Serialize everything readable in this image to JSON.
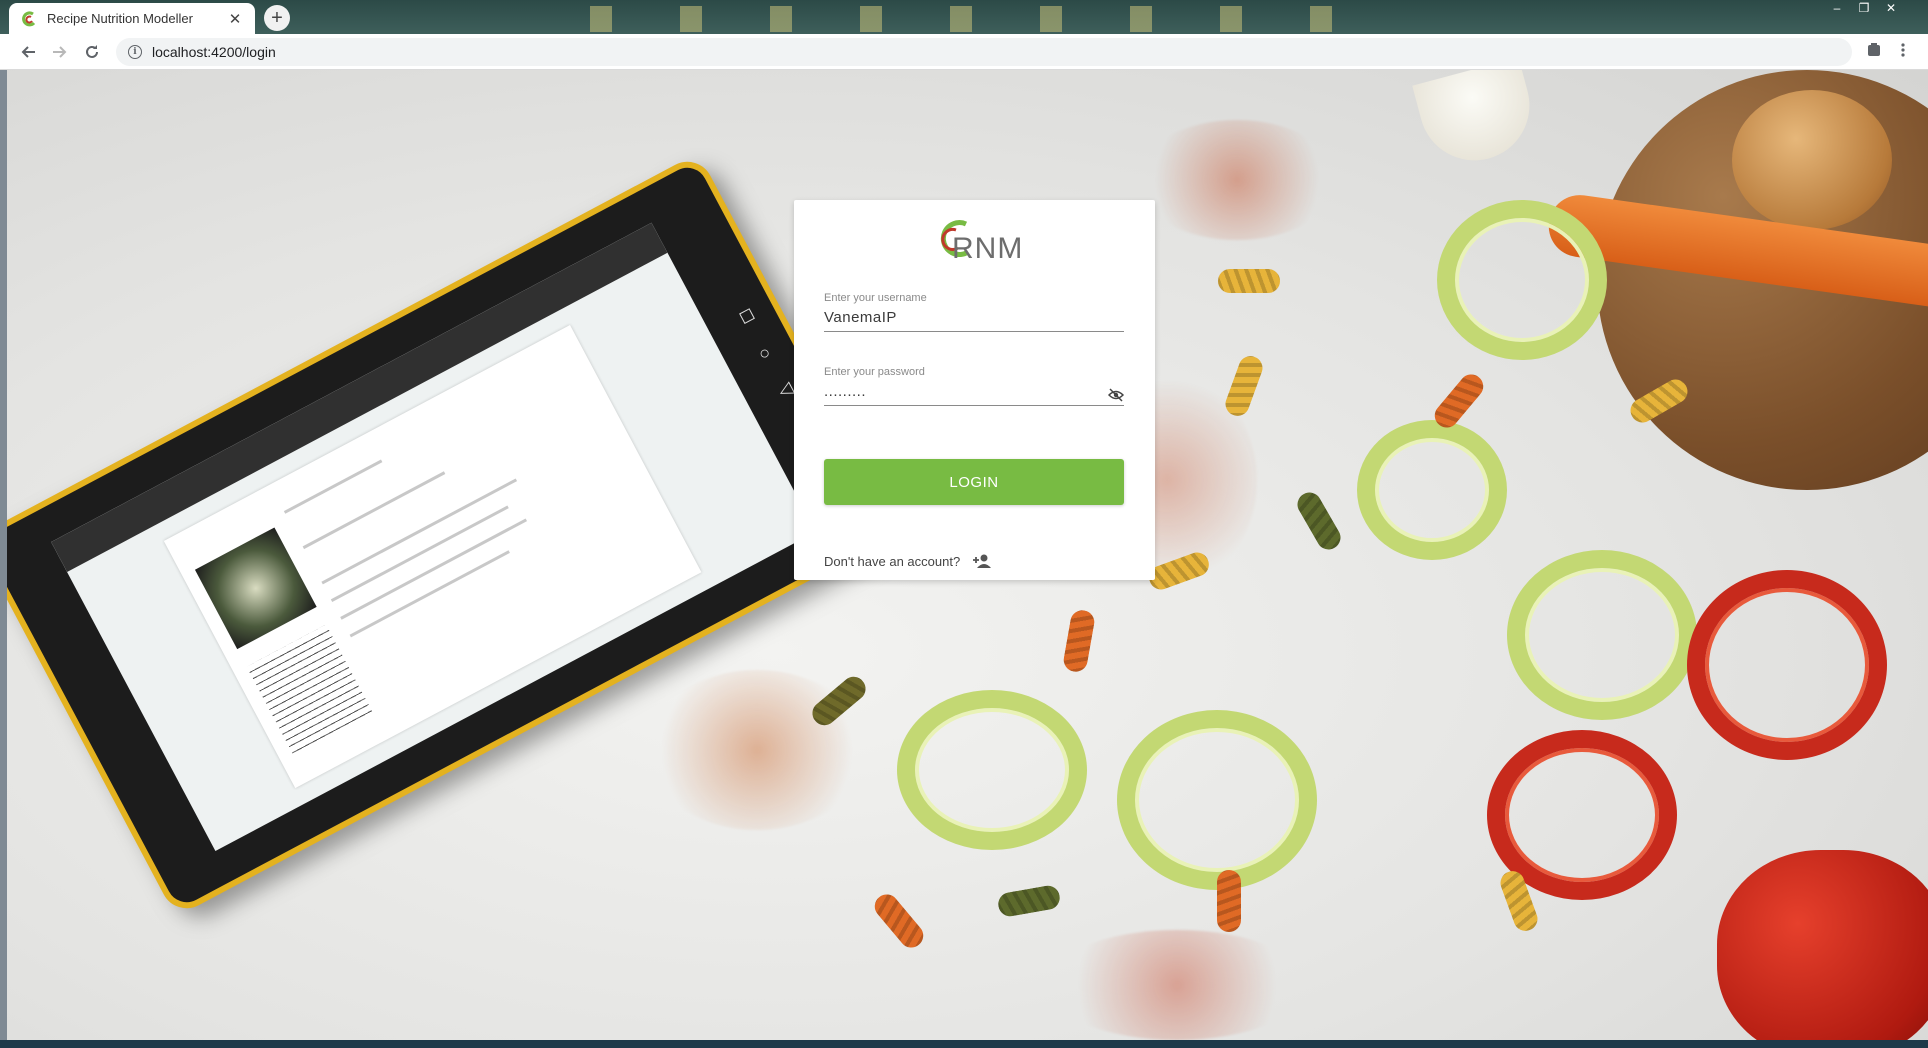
{
  "browser": {
    "tab_title": "Recipe Nutrition Modeller",
    "new_tab_icon": "plus-icon",
    "url": "localhost:4200/login",
    "window_controls": [
      "–",
      "❐",
      "✕"
    ]
  },
  "login": {
    "logo_text": "RNM",
    "username": {
      "label": "Enter your username",
      "value": "VanemaIP"
    },
    "password": {
      "label": "Enter your password",
      "value": ".........",
      "toggle_icon": "eye-off-icon"
    },
    "login_button": "LOGIN",
    "signup_text": "Don't have an account?",
    "signup_icon": "person-add-icon"
  },
  "colors": {
    "primary": "#78bb43",
    "logo_green": "#78bb43",
    "logo_red": "#c0392b"
  }
}
